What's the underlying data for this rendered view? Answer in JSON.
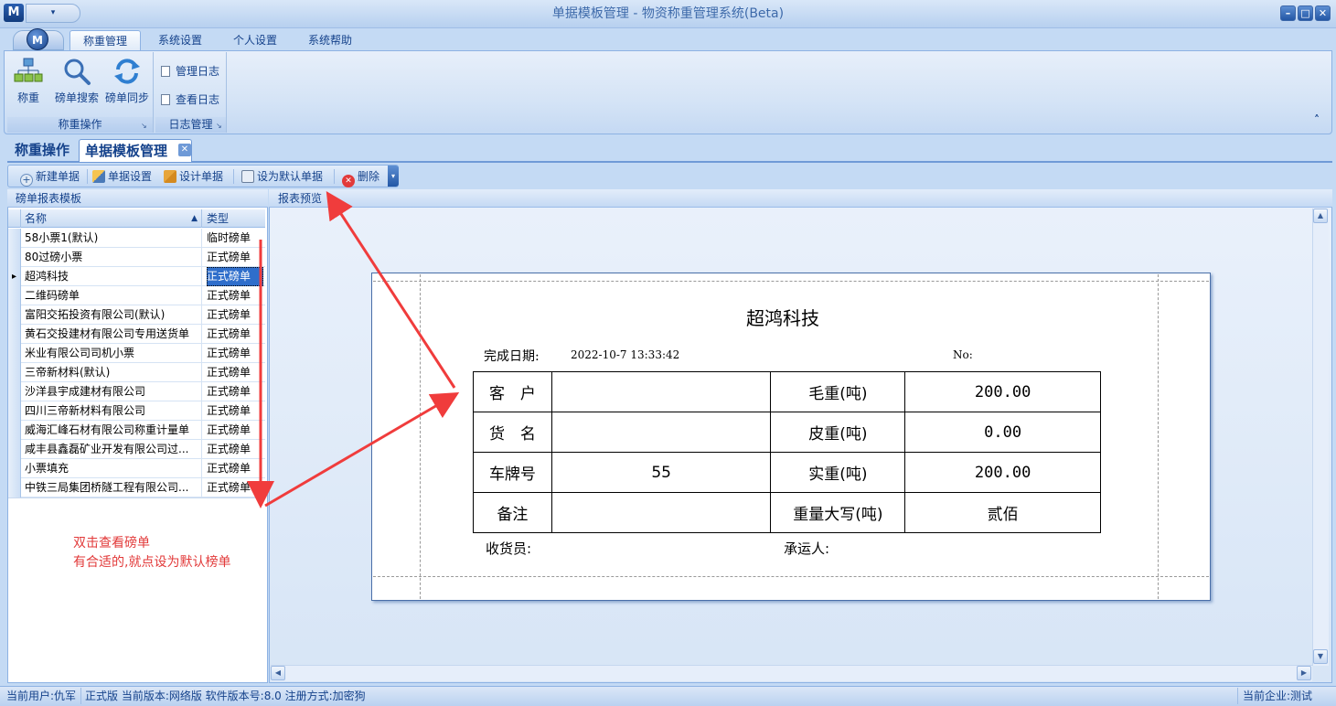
{
  "window": {
    "title": "单据模板管理 - 物资称重管理系统(Beta)",
    "app_logo": "M",
    "qat_label": "▾",
    "controls": [
      "minimize-icon",
      "maximize-icon",
      "close-icon"
    ]
  },
  "ribbon": {
    "app_button": "M",
    "tabs": [
      "称重管理",
      "系统设置",
      "个人设置",
      "系统帮助"
    ],
    "groups": {
      "weigh_ops": {
        "title": "称重操作",
        "buttons": [
          {
            "label": "称重",
            "icon": "scale-network-icon"
          },
          {
            "label": "磅单搜索",
            "icon": "magnifier-icon"
          },
          {
            "label": "磅单同步",
            "icon": "sync-icon"
          }
        ]
      },
      "log_mgmt": {
        "title": "日志管理",
        "buttons": [
          {
            "label": "管理日志",
            "icon": "document-icon"
          },
          {
            "label": "查看日志",
            "icon": "document-icon"
          }
        ]
      }
    },
    "collapse_glyph": "˄"
  },
  "doc_tabs": [
    "称重操作",
    "单据模板管理"
  ],
  "doc_tab_close": "✕",
  "toolbar": {
    "new": "新建单据",
    "settings": "单据设置",
    "design": "设计单据",
    "set_default": "设为默认单据",
    "delete": "删除"
  },
  "left_panel": {
    "title": "磅单报表模板",
    "columns": {
      "name": "名称",
      "type": "类型"
    },
    "sort_glyph": "▲",
    "rows": [
      {
        "name": "58小票1(默认)",
        "type": "临时磅单"
      },
      {
        "name": "80过磅小票",
        "type": "正式磅单"
      },
      {
        "name": "超鸿科技",
        "type": "正式磅单",
        "selected": true
      },
      {
        "name": "二维码磅单",
        "type": "正式磅单"
      },
      {
        "name": "富阳交拓投资有限公司(默认)",
        "type": "正式磅单"
      },
      {
        "name": "黄石交投建材有限公司专用送货单",
        "type": "正式磅单"
      },
      {
        "name": "米业有限公司司机小票",
        "type": "正式磅单"
      },
      {
        "name": "三帝新材料(默认)",
        "type": "正式磅单"
      },
      {
        "name": "沙洋县宇成建材有限公司",
        "type": "正式磅单"
      },
      {
        "name": "四川三帝新材料有限公司",
        "type": "正式磅单"
      },
      {
        "name": "威海汇峰石材有限公司称重计量单",
        "type": "正式磅单"
      },
      {
        "name": "咸丰县鑫磊矿业开发有限公司过...",
        "type": "正式磅单"
      },
      {
        "name": "小票填充",
        "type": "正式磅单"
      },
      {
        "name": "中铁三局集团桥隧工程有限公司...",
        "type": "正式磅单"
      }
    ],
    "annotation_line1": "双击查看磅单",
    "annotation_line2": "有合适的,就点设为默认榜单"
  },
  "right_panel": {
    "title": "报表预览",
    "report": {
      "title": "超鸿科技",
      "date_label": "完成日期:",
      "date_value": "2022-10-7 13:33:42",
      "no_label": "No:",
      "rows": [
        [
          "客　户",
          "",
          "毛重(吨)",
          "200.00"
        ],
        [
          "货　名",
          "",
          "皮重(吨)",
          "0.00"
        ],
        [
          "车牌号",
          "55",
          "实重(吨)",
          "200.00"
        ],
        [
          "备注",
          "",
          "重量大写(吨)",
          "贰佰"
        ]
      ],
      "receiver_label": "收货员:",
      "carrier_label": "承运人:"
    }
  },
  "statusbar": {
    "user": "当前用户:仇军",
    "info": "正式版 当前版本:网络版 软件版本号:8.0 注册方式:加密狗",
    "company": "当前企业:测试"
  },
  "colors": {
    "accent": "#15428b",
    "selection": "#2f6ecb",
    "annotation": "#e23a3a"
  }
}
